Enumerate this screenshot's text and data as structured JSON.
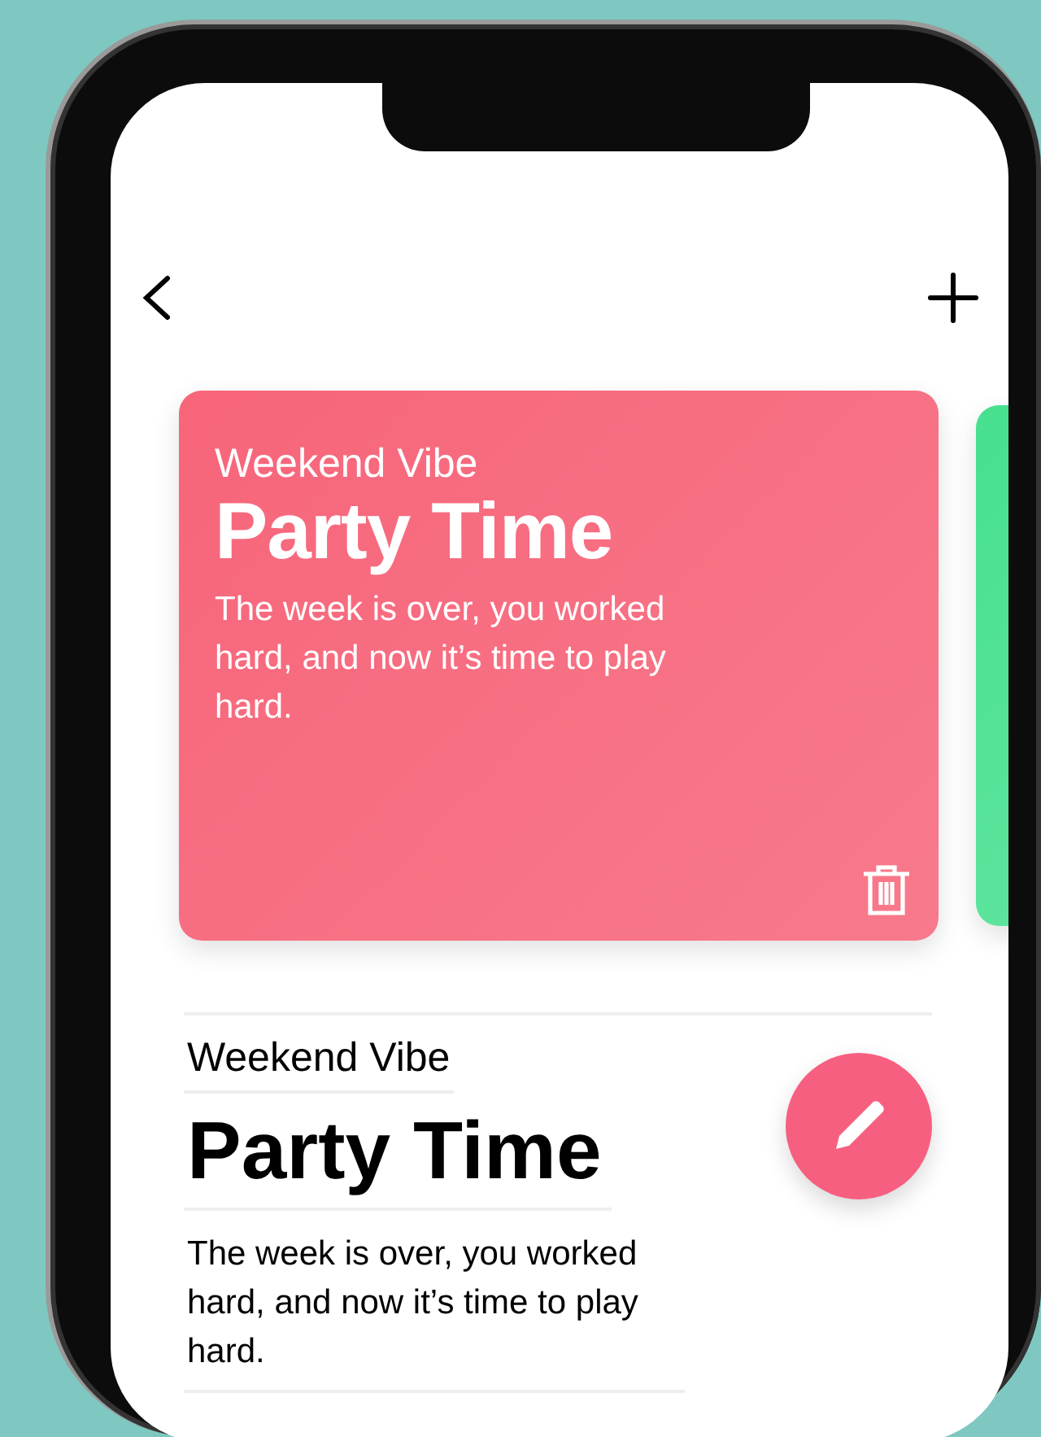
{
  "cards": [
    {
      "subtitle": "Weekend Vibe",
      "title": "Party Time",
      "description": "The week is over, you worked hard, and now it’s time to play hard.",
      "color": "#f7657a",
      "deletable": true
    },
    {
      "color": "#46e08f",
      "deletable": false
    }
  ],
  "detail": {
    "subtitle": "Weekend Vibe",
    "title": "Party Time",
    "description": "The week is over, you worked hard, and now it’s time to play hard."
  }
}
